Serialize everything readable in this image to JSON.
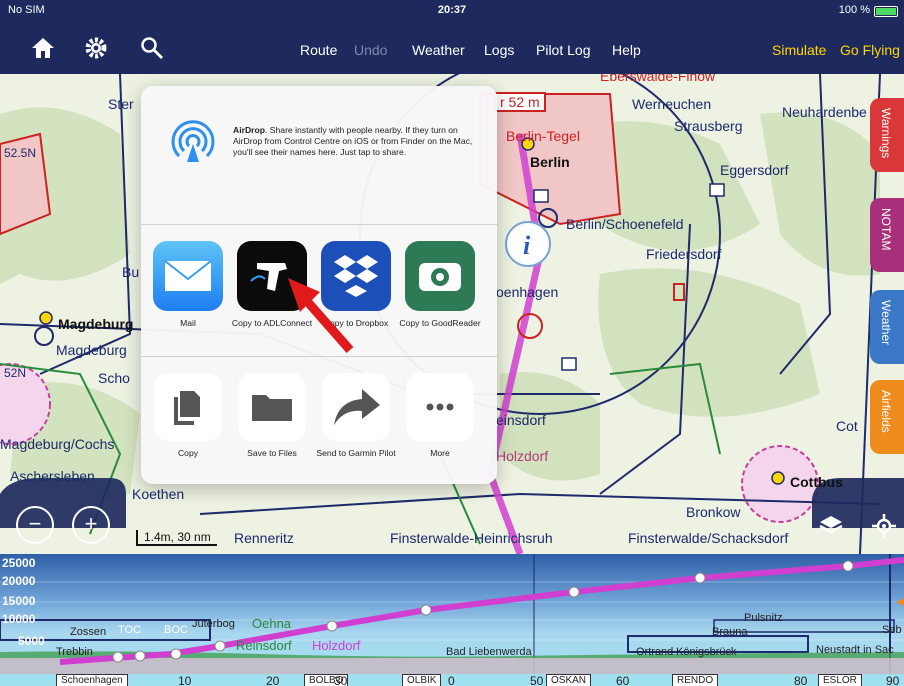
{
  "status_bar": {
    "carrier": "No SIM",
    "time": "20:37",
    "battery": "100 %"
  },
  "nav": {
    "route": "Route",
    "undo": "Undo",
    "weather": "Weather",
    "logs": "Logs",
    "pilot_log": "Pilot Log",
    "help": "Help",
    "simulate": "Simulate",
    "go_flying": "Go Flying"
  },
  "map_labels": {
    "eberswalde": "Eberswalde-Finow",
    "werneuchen": "Werneuchen",
    "neuhardenberg": "Neuhardenbe",
    "strausberg": "Strausberg",
    "berlin_tegel": "Berlin-Tegel",
    "berlin": "Berlin",
    "eggersdorf": "Eggersdorf",
    "schoenefeld": "Berlin/Schoenefeld",
    "friedersdorf": "Friedersdorf",
    "schoenhagen": "oenhagen",
    "magdeburg": "Magdeburg",
    "magdeburg_city": "Magdeburg",
    "schonebeck": "Scho",
    "magdeburg_cochstedt": "Magdeburg/Cochs",
    "aschersleben": "Aschersleben",
    "koethen": "Koethen",
    "einsdorf": "einsdorf",
    "holzdorf": "Holzdorf",
    "cottbus": "Cottbus",
    "cott": "Cot",
    "bronkow": "Bronkow",
    "finsterwalde_heinrichsruh": "Finsterwalde-Heinrichsruh",
    "finsterwalde_schacksdorf": "Finsterwalde/Schacksdorf",
    "renneritz": "Renneritz",
    "lat_52_5": "52.5N",
    "lat_52": "52N",
    "ster": "Ster",
    "bu": "Bu",
    "top_alt": "r 52 m"
  },
  "side_tabs": [
    "Warnings",
    "NOTAM",
    "Weather",
    "Airfields"
  ],
  "share_sheet": {
    "airdrop_title": "AirDrop",
    "airdrop_text": ". Share instantly with people nearby. If they turn on AirDrop from Control Centre on iOS or from Finder on the Mac, you'll see their names here. Just tap to share.",
    "apps": [
      {
        "label": "Mail"
      },
      {
        "label": "Copy to ADLConnect"
      },
      {
        "label": "Copy to Dropbox"
      },
      {
        "label": "Copy to GoodReader"
      }
    ],
    "actions": [
      {
        "label": "Copy"
      },
      {
        "label": "Save to Files"
      },
      {
        "label": "Send to Garmin Pilot"
      },
      {
        "label": "More"
      }
    ]
  },
  "map_controls": {
    "scale": "1.4m, 30 nm"
  },
  "profile": {
    "altitudes": [
      "25000",
      "20000",
      "15000",
      "10000",
      "5000"
    ],
    "labels": {
      "zossen": "Zossen",
      "toc": "TOC",
      "boc": "BOC",
      "juterbog": "Jüterbog",
      "oehna": "Oehna",
      "reinsdorf": "Reinsdorf",
      "holzdorf": "Holzdorf",
      "trebbin": "Trebbin",
      "bad_liebenwerda": "Bad Liebenwerda",
      "ortrand": "Ortrand",
      "konigsbruck": "Königsbrück",
      "brauna": "Brauna",
      "pulsnitz": "Pulsnitz",
      "neustadt": "Neustadt in Sac",
      "seb": "Seb"
    },
    "distance_ticks": [
      "10",
      "20",
      "30",
      "0",
      "50",
      "60",
      "80",
      "90"
    ],
    "waypoints": [
      "Schoenhagen",
      "BOLBO",
      "OLBIK",
      "OSKAN",
      "RENDO",
      "ESLOR"
    ]
  }
}
